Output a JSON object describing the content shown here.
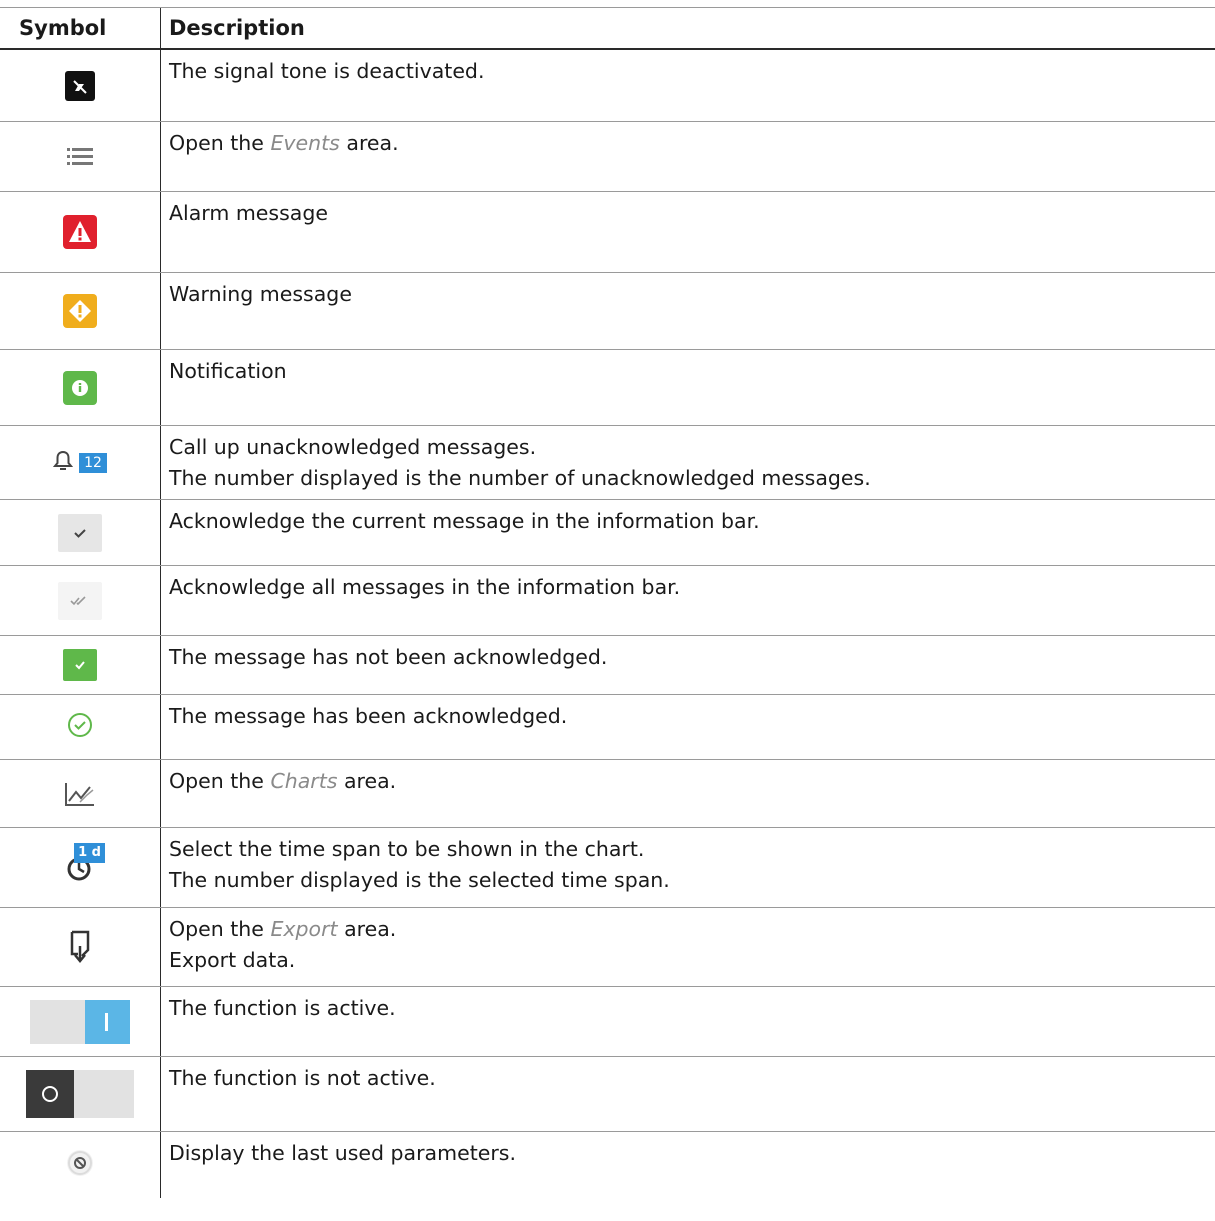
{
  "header": {
    "symbol": "Symbol",
    "description": "Description"
  },
  "rows": [
    {
      "icon": "signal-tone-off-icon",
      "lines": [
        "The signal tone is deactivated."
      ]
    },
    {
      "icon": "events-list-icon",
      "pre": "Open the ",
      "em": "Events",
      "post": " area."
    },
    {
      "icon": "alarm-icon",
      "lines": [
        "Alarm message"
      ]
    },
    {
      "icon": "warning-icon",
      "lines": [
        "Warning message"
      ]
    },
    {
      "icon": "notification-icon",
      "lines": [
        "Notification"
      ]
    },
    {
      "icon": "bell-icon",
      "badge": "12",
      "lines": [
        "Call up unacknowledged messages.",
        "The number displayed is the number of unacknowledged messages."
      ]
    },
    {
      "icon": "check-icon",
      "lines": [
        "Acknowledge the current message in the information bar."
      ]
    },
    {
      "icon": "double-check-icon",
      "lines": [
        "Acknowledge all messages in the information bar."
      ]
    },
    {
      "icon": "unacknowledged-check-icon",
      "lines": [
        "The message has not been acknowledged."
      ]
    },
    {
      "icon": "acknowledged-circle-check-icon",
      "lines": [
        "The message has been acknowledged."
      ]
    },
    {
      "icon": "charts-icon",
      "pre": "Open the ",
      "em": "Charts",
      "post": " area."
    },
    {
      "icon": "time-span-icon",
      "badge": "1 d",
      "lines": [
        "Select the time span to be shown in the chart.",
        "The number displayed is the selected time span."
      ]
    },
    {
      "icon": "export-icon",
      "pre": "Open the ",
      "em": "Export",
      "post": " area.",
      "line2": "Export data."
    },
    {
      "icon": "toggle-on-icon",
      "lines": [
        "The function is active."
      ]
    },
    {
      "icon": "toggle-off-icon",
      "lines": [
        "The function is not active."
      ]
    },
    {
      "icon": "history-icon",
      "lines": [
        "Display the last used parameters."
      ]
    }
  ]
}
